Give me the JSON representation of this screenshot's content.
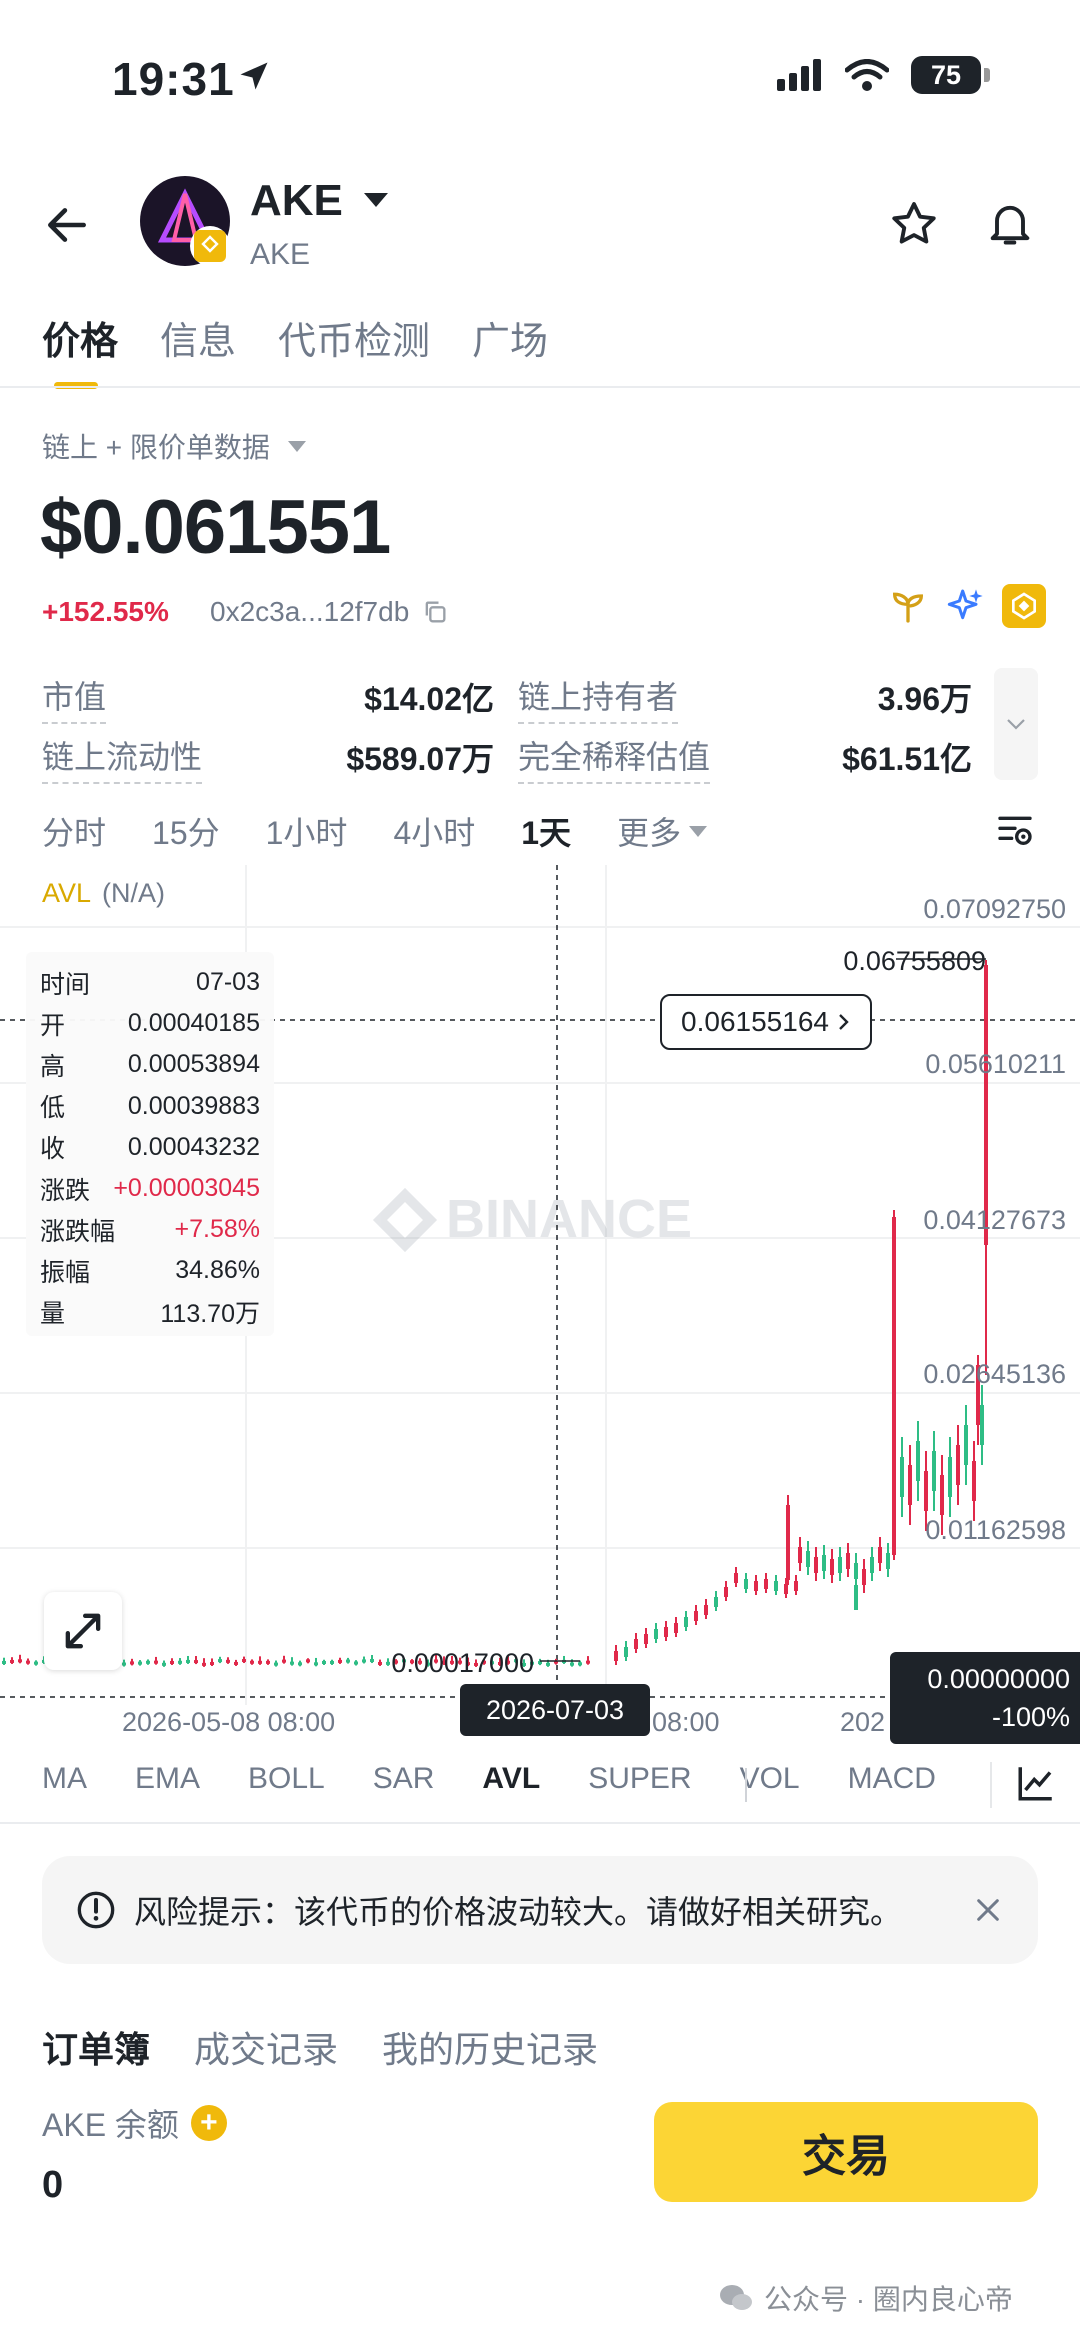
{
  "status_bar": {
    "time": "19:31",
    "battery": "75"
  },
  "header": {
    "coin_name": "AKE",
    "coin_sub": "AKE"
  },
  "tabs": [
    {
      "label": "价格"
    },
    {
      "label": "信息"
    },
    {
      "label": "代币检测"
    },
    {
      "label": "广场"
    }
  ],
  "data_source": "链上 + 限价单数据",
  "price": "$0.061551",
  "change": "+152.55%",
  "contract": "0x2c3a...12f7db",
  "stats": {
    "market_cap_label": "市值",
    "market_cap": "$14.02亿",
    "holders_label": "链上持有者",
    "holders": "3.96万",
    "liquidity_label": "链上流动性",
    "liquidity": "$589.07万",
    "fdv_label": "完全稀释估值",
    "fdv": "$61.51亿"
  },
  "intervals": [
    "分时",
    "15分",
    "1小时",
    "4小时",
    "1天",
    "更多"
  ],
  "active_interval": "1天",
  "chart": {
    "avl_label": "AVL",
    "avl_value": "(N/A)",
    "watermark": "BINANCE",
    "y_axis_labels": [
      "0.07092750",
      "0.05610211",
      "0.04127673",
      "0.02645136",
      "0.01162598"
    ],
    "high_label": "0.06755809",
    "low_label": "0.00017000",
    "current_price": "0.06155164",
    "crosshair_date": "2026-07-03",
    "x_labels": [
      "2026-05-08 08:00",
      "08:00",
      "202"
    ],
    "crosshair_value": "0.00000000",
    "crosshair_pct": "-100%",
    "ohlc": [
      {
        "k": "时间",
        "v": "07-03"
      },
      {
        "k": "开",
        "v": "0.00040185"
      },
      {
        "k": "高",
        "v": "0.00053894"
      },
      {
        "k": "低",
        "v": "0.00039883"
      },
      {
        "k": "收",
        "v": "0.00043232"
      },
      {
        "k": "涨跌",
        "v": "+0.00003045",
        "red": true
      },
      {
        "k": "涨跌幅",
        "v": "+7.58%",
        "red": true
      },
      {
        "k": "振幅",
        "v": "34.86%"
      },
      {
        "k": "量",
        "v": "113.70万"
      }
    ]
  },
  "indicators": [
    "MA",
    "EMA",
    "BOLL",
    "SAR",
    "AVL",
    "SUPER",
    "VOL",
    "MACD"
  ],
  "active_indicator": "AVL",
  "risk_text": "风险提示：该代币的价格波动较大。请做好相关研究。",
  "orderbook_tabs": [
    "订单簿",
    "成交记录",
    "我的历史记录"
  ],
  "balance_label": "AKE 余额",
  "balance_value": "0",
  "trade_label": "交易",
  "footer_watermark": "公众号 · 圈内良心帝",
  "colors": {
    "accent": "#f0b90b",
    "up": "#e0294a",
    "down": "#2ebd85"
  }
}
